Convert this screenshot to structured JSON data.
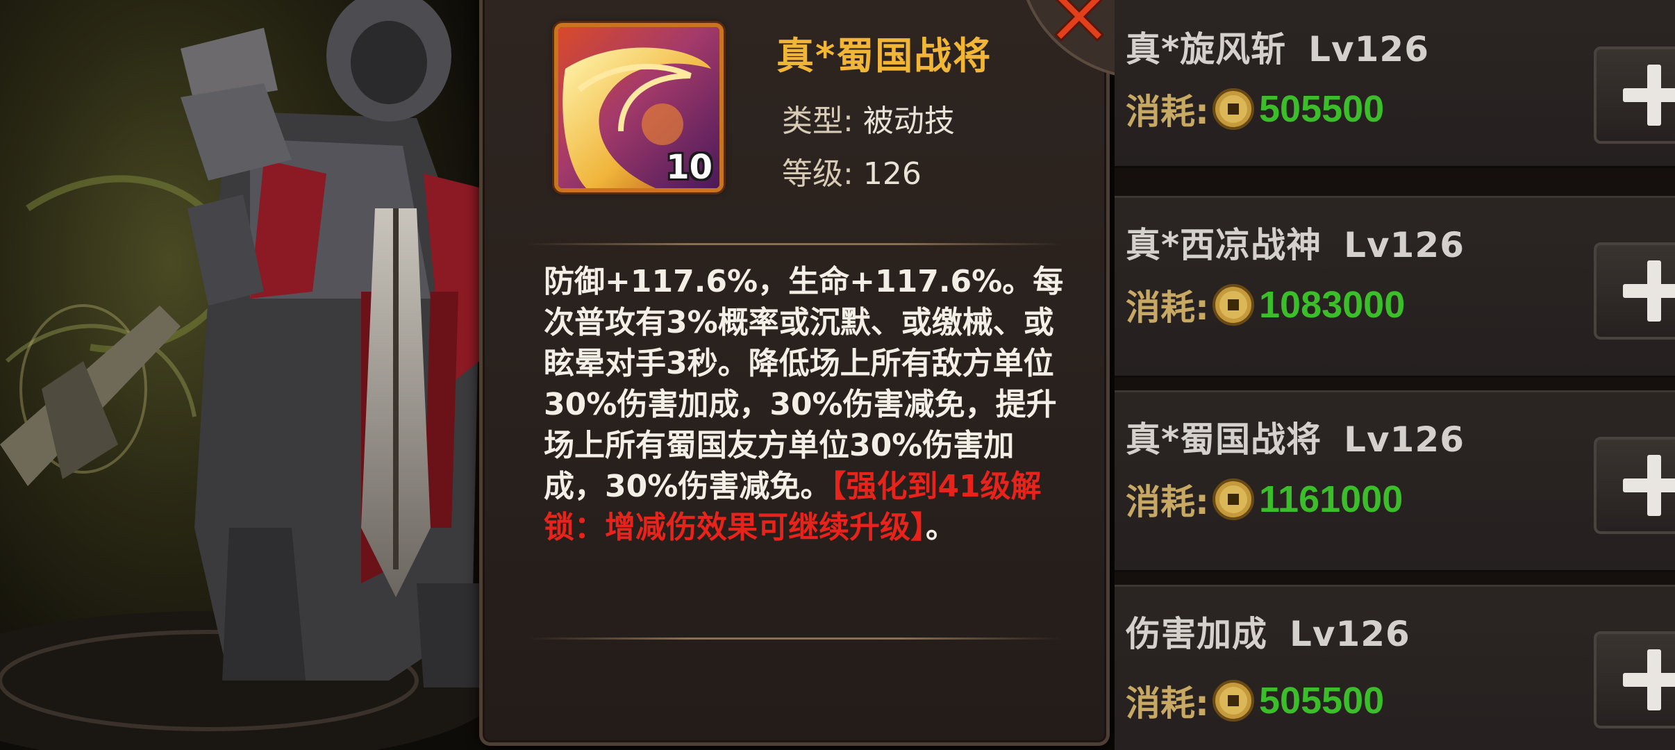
{
  "popup": {
    "skill_name": "真*蜀国战将",
    "icon_level": "10",
    "type_label": "类型:",
    "type_value": "被动技",
    "level_label": "等级:",
    "level_value": "126",
    "description_white": "防御+117.6%，生命+117.6%。每次普攻有3%概率或沉默、或缴械、或眩晕对手3秒。降低场上所有敌方单位30%伤害加成，30%伤害减免，提升场上所有蜀国友方单位30%伤害加成，30%伤害减免。",
    "description_red": "【强化到41级解锁：增减伤效果可继续升级】",
    "description_tail": "。"
  },
  "skill_list": {
    "cost_label": "消耗:",
    "items": [
      {
        "name": "真*旋风斩",
        "level": "Lv126",
        "cost": "505500"
      },
      {
        "name": "真*西凉战神",
        "level": "Lv126",
        "cost": "1083000"
      },
      {
        "name": "真*蜀国战将",
        "level": "Lv126",
        "cost": "1161000"
      },
      {
        "name": "伤害加成",
        "level": "Lv126",
        "cost": "505500"
      }
    ]
  },
  "colors": {
    "skill_name": "#f2b637",
    "cost_value": "#3cbd2a",
    "red_text": "#e8231b",
    "icon_border": "#c9741e"
  },
  "icons": [
    "close-icon",
    "coin-icon",
    "plus-icon",
    "skill-icon"
  ]
}
